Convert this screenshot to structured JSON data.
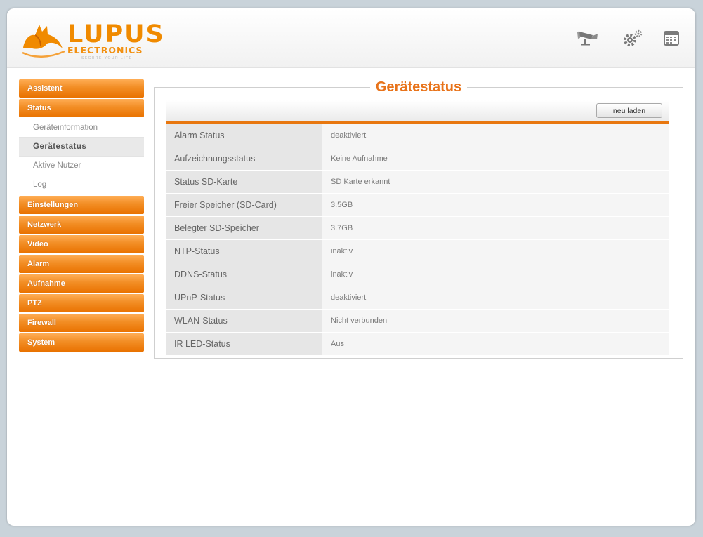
{
  "header": {
    "logo_word": "LUPUS",
    "logo_sub": "ELECTRONICS",
    "logo_tagline": "SECURE YOUR LIFE",
    "icons": [
      "camera-icon",
      "gear-icon",
      "calendar-icon"
    ]
  },
  "sidebar": {
    "items": [
      {
        "label": "Assistent",
        "type": "main"
      },
      {
        "label": "Status",
        "type": "main"
      },
      {
        "label": "Geräteinformation",
        "type": "sub"
      },
      {
        "label": "Gerätestatus",
        "type": "sub",
        "active": true
      },
      {
        "label": "Aktive Nutzer",
        "type": "sub"
      },
      {
        "label": "Log",
        "type": "sub"
      },
      {
        "label": "Einstellungen",
        "type": "main"
      },
      {
        "label": "Netzwerk",
        "type": "main"
      },
      {
        "label": "Video",
        "type": "main"
      },
      {
        "label": "Alarm",
        "type": "main"
      },
      {
        "label": "Aufnahme",
        "type": "main"
      },
      {
        "label": "PTZ",
        "type": "main"
      },
      {
        "label": "Firewall",
        "type": "main"
      },
      {
        "label": "System",
        "type": "main"
      }
    ]
  },
  "main": {
    "title": "Gerätestatus",
    "reload_label": "neu laden",
    "rows": [
      {
        "key": "Alarm Status",
        "value": "deaktiviert"
      },
      {
        "key": "Aufzeichnungsstatus",
        "value": "Keine Aufnahme"
      },
      {
        "key": "Status SD-Karte",
        "value": "SD Karte erkannt"
      },
      {
        "key": "Freier Speicher (SD-Card)",
        "value": "3.5GB"
      },
      {
        "key": "Belegter SD-Speicher",
        "value": "3.7GB"
      },
      {
        "key": "NTP-Status",
        "value": "inaktiv"
      },
      {
        "key": "DDNS-Status",
        "value": "inaktiv"
      },
      {
        "key": "UPnP-Status",
        "value": "deaktiviert"
      },
      {
        "key": "WLAN-Status",
        "value": "Nicht verbunden"
      },
      {
        "key": "IR LED-Status",
        "value": "Aus"
      }
    ]
  },
  "colors": {
    "accent": "#f08a00",
    "nav_gradient_top": "#ffad55",
    "nav_gradient_bottom": "#e97200",
    "title": "#e8731a",
    "background": "#c9d3da"
  }
}
